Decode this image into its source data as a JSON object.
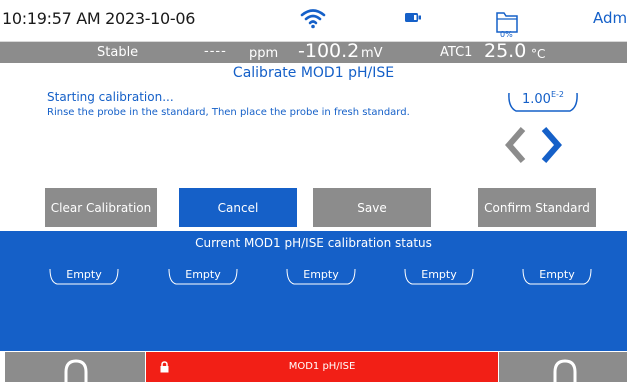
{
  "status_bar": {
    "datetime": "10:19:57 AM 2023-10-06",
    "storage_percent": "0%",
    "user": "Admir",
    "icons": [
      "wifi-icon",
      "battery-icon",
      "storage-folder-icon"
    ]
  },
  "measurement": {
    "stability": "Stable",
    "ppm_value": "----",
    "ppm_unit": "ppm",
    "reading": "-100.2",
    "reading_unit": "mV",
    "atc": "ATC1",
    "temperature": "25.0",
    "temperature_unit": "°C"
  },
  "calibration": {
    "title": "Calibrate MOD1 pH/ISE",
    "message_line1": "Starting calibration...",
    "message_line2": "Rinse the probe in the standard, Then place the probe in fresh standard.",
    "standard_mantissa": "1.00",
    "standard_exponent": "E-2"
  },
  "buttons": {
    "clear": "Clear Calibration",
    "cancel": "Cancel",
    "save": "Save",
    "confirm": "Confirm Standard"
  },
  "status_panel": {
    "title": "Current MOD1 pH/ISE calibration status",
    "slots": [
      "Empty",
      "Empty",
      "Empty",
      "Empty",
      "Empty"
    ]
  },
  "bottom": {
    "module_label": "MOD1 pH/ISE"
  },
  "colors": {
    "accent_blue": "#1560c8",
    "gray": "#8c8c8c",
    "module_red": "#f21f16"
  }
}
